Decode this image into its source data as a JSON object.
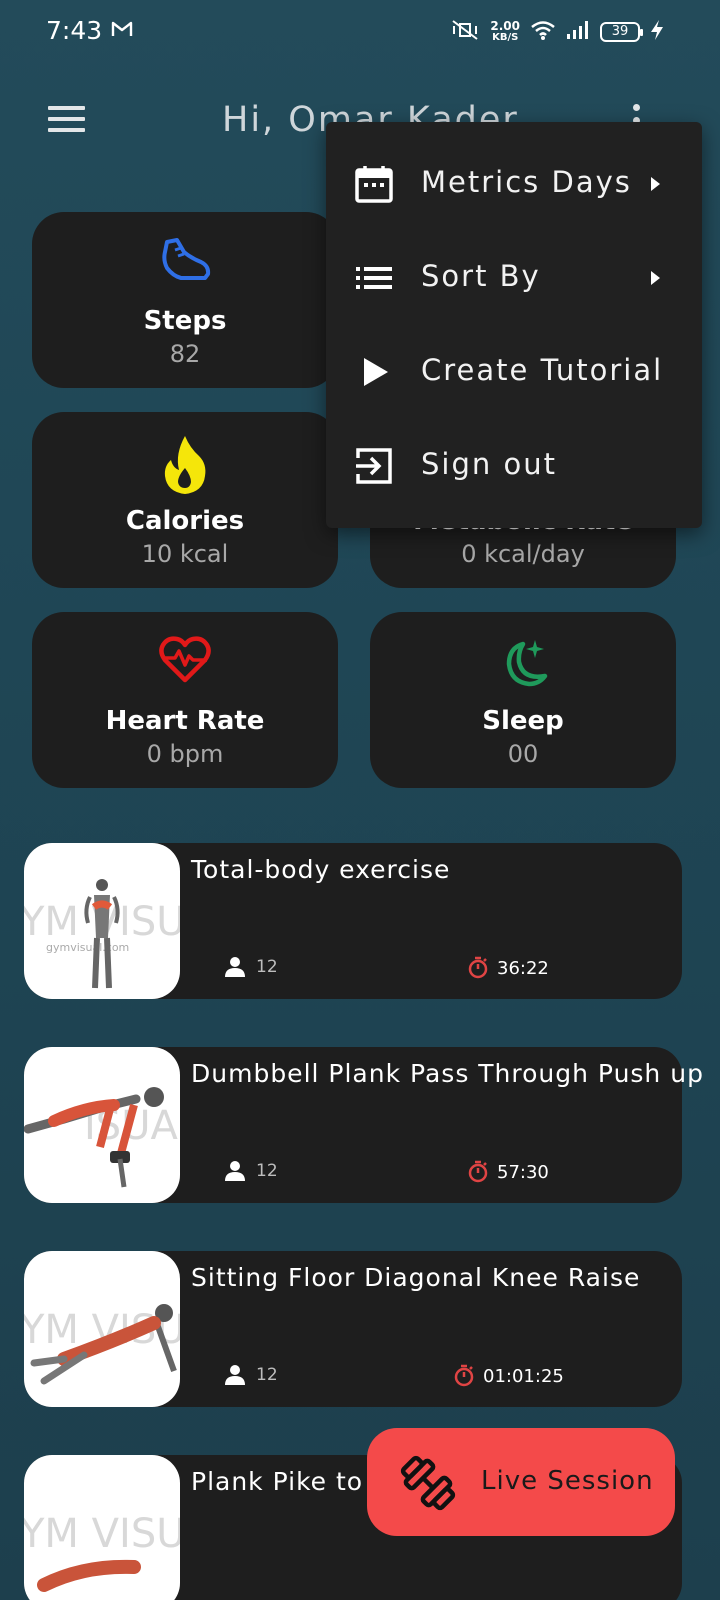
{
  "status_bar": {
    "time": "7:43",
    "speed_value": "2.00",
    "speed_unit": "KB/S",
    "battery": "39",
    "icons": [
      "gmail-icon",
      "mute-vibrate-icon",
      "wifi-icon",
      "signal-icon",
      "charging-icon"
    ]
  },
  "app_bar": {
    "greeting": "Hi, Omar Kader",
    "icons": [
      "hamburger-menu-icon",
      "more-vert-icon"
    ]
  },
  "metrics": {
    "steps": {
      "label": "Steps",
      "value": "82",
      "icon": "shoe-icon",
      "color": "#2f6fe6"
    },
    "metabolic": {
      "label": "Metabolic Rate",
      "value": "0 kcal/day",
      "icon": "metabolic-icon"
    },
    "calories": {
      "label": "Calories",
      "value": "10 kcal",
      "icon": "flame-icon",
      "color": "#f5e60a"
    },
    "heart_rate": {
      "label": "Heart Rate",
      "value": "0 bpm",
      "icon": "heart-pulse-icon",
      "color": "#e11919"
    },
    "sleep": {
      "label": "Sleep",
      "value": "00",
      "icon": "moon-icon",
      "color": "#1f9a5b"
    }
  },
  "exercises": [
    {
      "title": "Total-body exercise",
      "participants": "12",
      "duration": "36:22"
    },
    {
      "title": "Dumbbell Plank Pass Through Push up",
      "participants": "12",
      "duration": "57:30"
    },
    {
      "title": "Sitting Floor Diagonal Knee Raise",
      "participants": "12",
      "duration": "01:01:25"
    },
    {
      "title": "Plank Pike to",
      "participants": "",
      "duration": ""
    }
  ],
  "popup_menu": {
    "items": [
      {
        "label": "Metrics Days",
        "icon": "calendar-icon",
        "has_submenu": true
      },
      {
        "label": "Sort By",
        "icon": "list-icon",
        "has_submenu": true
      },
      {
        "label": "Create Tutorial",
        "icon": "play-icon",
        "has_submenu": false
      },
      {
        "label": "Sign out",
        "icon": "sign-out-icon",
        "has_submenu": false
      }
    ]
  },
  "fab": {
    "label": "Live Session",
    "icon": "dumbbell-icon",
    "color": "#f44a4a"
  },
  "colors": {
    "background": "#234b5a",
    "card": "#1e1e1e",
    "popup": "#212121",
    "timer_accent": "#e04444"
  }
}
